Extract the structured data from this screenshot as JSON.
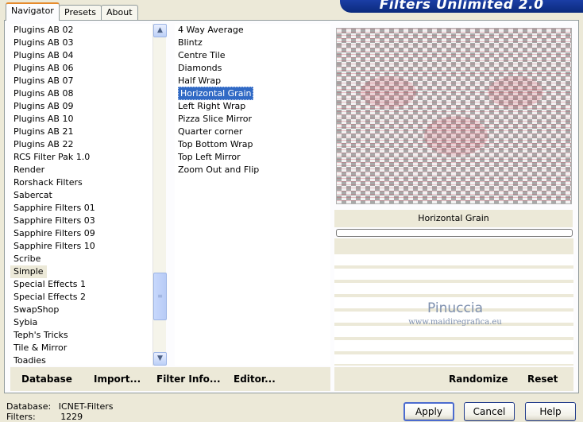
{
  "banner": {
    "title": "Filters Unlimited 2.0"
  },
  "tabs": [
    {
      "label": "Navigator",
      "active": true
    },
    {
      "label": "Presets",
      "active": false
    },
    {
      "label": "About",
      "active": false
    }
  ],
  "categories": {
    "items": [
      "Plugins AB 02",
      "Plugins AB 03",
      "Plugins AB 04",
      "Plugins AB 06",
      "Plugins AB 07",
      "Plugins AB 08",
      "Plugins AB 09",
      "Plugins AB 10",
      "Plugins AB 21",
      "Plugins AB 22",
      "RCS Filter Pak 1.0",
      "Render",
      "Rorshack Filters",
      "Sabercat",
      "Sapphire Filters 01",
      "Sapphire Filters 03",
      "Sapphire Filters 09",
      "Sapphire Filters 10",
      "Scribe",
      "Simple",
      "Special Effects 1",
      "Special Effects 2",
      "SwapShop",
      "Sybia",
      "Teph's Tricks",
      "Tile & Mirror",
      "Toadies"
    ],
    "selected": "Simple"
  },
  "filters": {
    "items": [
      "4 Way Average",
      "Blintz",
      "Centre Tile",
      "Diamonds",
      "Half Wrap",
      "Horizontal Grain",
      "Left Right Wrap",
      "Pizza Slice Mirror",
      "Quarter corner",
      "Top Bottom Wrap",
      "Top Left Mirror",
      "Zoom Out and Flip"
    ],
    "selected": "Horizontal Grain"
  },
  "preview": {
    "filter_name": "Horizontal Grain",
    "progress": 0
  },
  "watermark": {
    "name": "Pinuccia",
    "site": "www.maidiregrafica.eu"
  },
  "left_toolbar": {
    "database": "Database",
    "import": "Import...",
    "filter_info": "Filter Info...",
    "editor": "Editor..."
  },
  "right_toolbar": {
    "randomize": "Randomize",
    "reset": "Reset"
  },
  "status": {
    "database_label": "Database:",
    "database_value": "ICNET-Filters",
    "filters_label": "Filters:",
    "filters_value": "1229"
  },
  "buttons": {
    "apply": "Apply",
    "cancel": "Cancel",
    "help": "Help"
  },
  "colors": {
    "banner": "#0b2a7c",
    "selection": "#316ac5",
    "window": "#ece9d8"
  }
}
